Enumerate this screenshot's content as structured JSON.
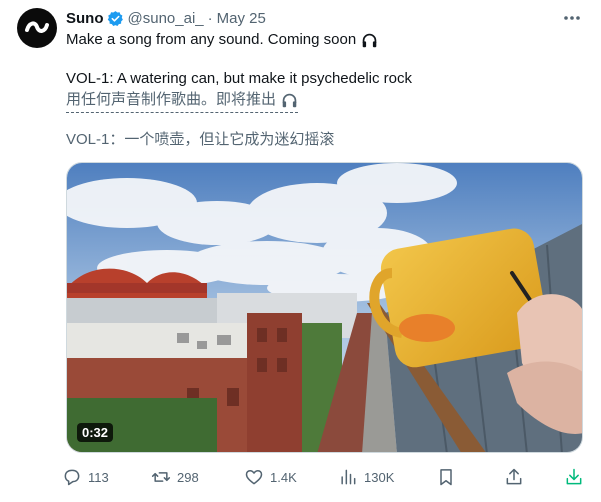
{
  "tweet": {
    "author_name": "Suno",
    "handle": "@suno_ai_",
    "separator": "·",
    "date": "May 25",
    "line1": "Make a song from any sound. Coming soon",
    "line2": "VOL-1: A watering can, but make it psychedelic rock",
    "translation_line1": "用任何声音制作歌曲。即将推出",
    "translation_line2": "VOL-1：一个喷壶，但让它成为迷幻摇滚",
    "video_duration": "0:32"
  },
  "actions": {
    "reply_count": "113",
    "retweet_count": "298",
    "like_count": "1.4K",
    "view_count": "130K"
  },
  "icons": [
    "suno-logo-icon",
    "verified-badge-icon",
    "more-icon",
    "headphones-icon",
    "reply-icon",
    "retweet-icon",
    "like-icon",
    "views-icon",
    "bookmark-icon",
    "share-icon",
    "download-icon"
  ],
  "colors": {
    "text": "#0f1419",
    "secondary": "#536471",
    "verified": "#1d9bf0",
    "download": "#00ba7c"
  }
}
